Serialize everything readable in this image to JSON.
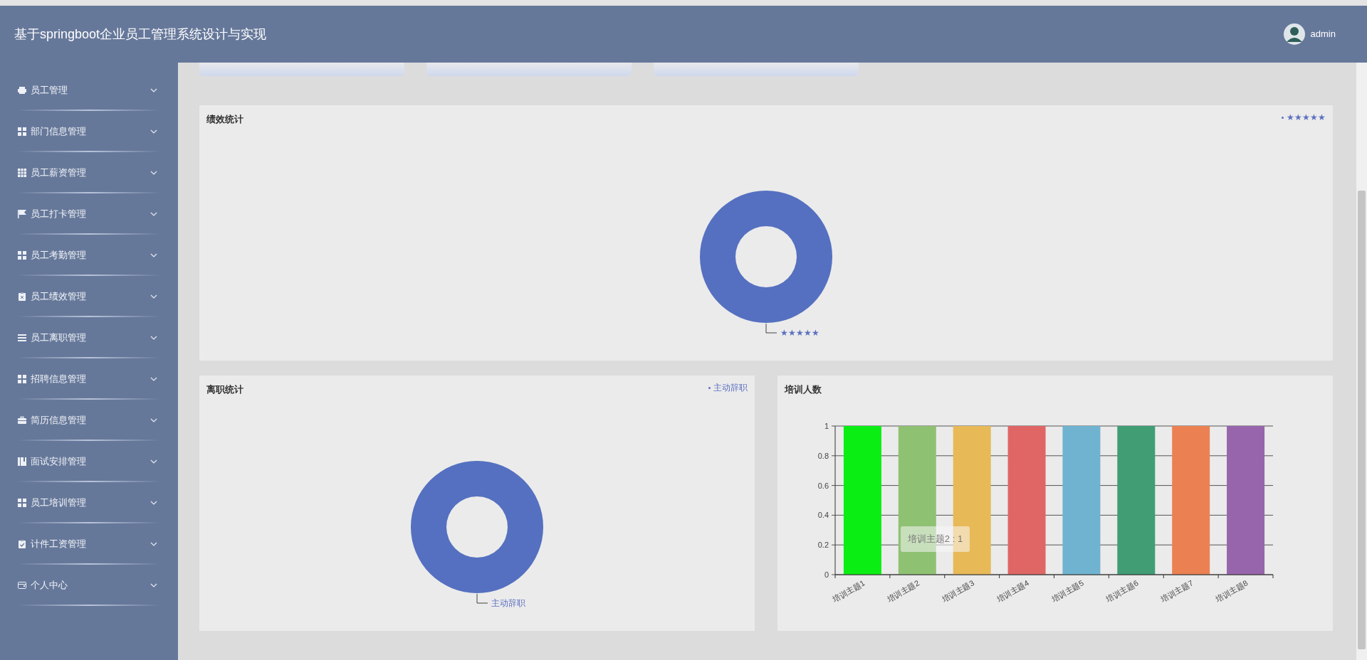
{
  "header": {
    "title": "基于springboot企业员工管理系统设计与实现",
    "user": "admin"
  },
  "sidebar": {
    "items": [
      {
        "label": "员工管理",
        "expanded": false
      },
      {
        "label": "部门信息管理",
        "expanded": false
      },
      {
        "label": "员工薪资管理",
        "expanded": false
      },
      {
        "label": "员工打卡管理",
        "expanded": false
      },
      {
        "label": "员工考勤管理",
        "expanded": false
      },
      {
        "label": "员工绩效管理",
        "expanded": false
      },
      {
        "label": "员工离职管理",
        "expanded": false
      },
      {
        "label": "招聘信息管理",
        "expanded": false
      },
      {
        "label": "简历信息管理",
        "expanded": false
      },
      {
        "label": "面试安排管理",
        "expanded": false
      },
      {
        "label": "员工培训管理",
        "expanded": false
      },
      {
        "label": "计件工资管理",
        "expanded": false
      },
      {
        "label": "个人中心",
        "expanded": false
      }
    ]
  },
  "performance_chart": {
    "title": "绩效统计",
    "legend": [
      "★★★★★"
    ],
    "slice_label": "★★★★★"
  },
  "resignation_chart": {
    "title": "离职统计",
    "legend": [
      "主动辞职"
    ],
    "slice_label": "主动辞职"
  },
  "training_chart": {
    "title": "培训人数",
    "tooltip": "培训主题2 : 1",
    "chart_data": {
      "type": "bar",
      "categories": [
        "培训主题1",
        "培训主题2",
        "培训主题3",
        "培训主题4",
        "培训主题5",
        "培训主题6",
        "培训主题7",
        "培训主题8"
      ],
      "values": [
        1,
        1,
        1,
        1,
        1,
        1,
        1,
        1
      ],
      "colors": [
        "#0aee14",
        "#8fc173",
        "#e8b957",
        "#e06666",
        "#6fb3d0",
        "#409d74",
        "#eb8153",
        "#9765ab"
      ],
      "grid": true,
      "ylim": [
        0,
        1
      ],
      "yticks": [
        0,
        0.2,
        0.4,
        0.6,
        0.8,
        1
      ]
    }
  }
}
